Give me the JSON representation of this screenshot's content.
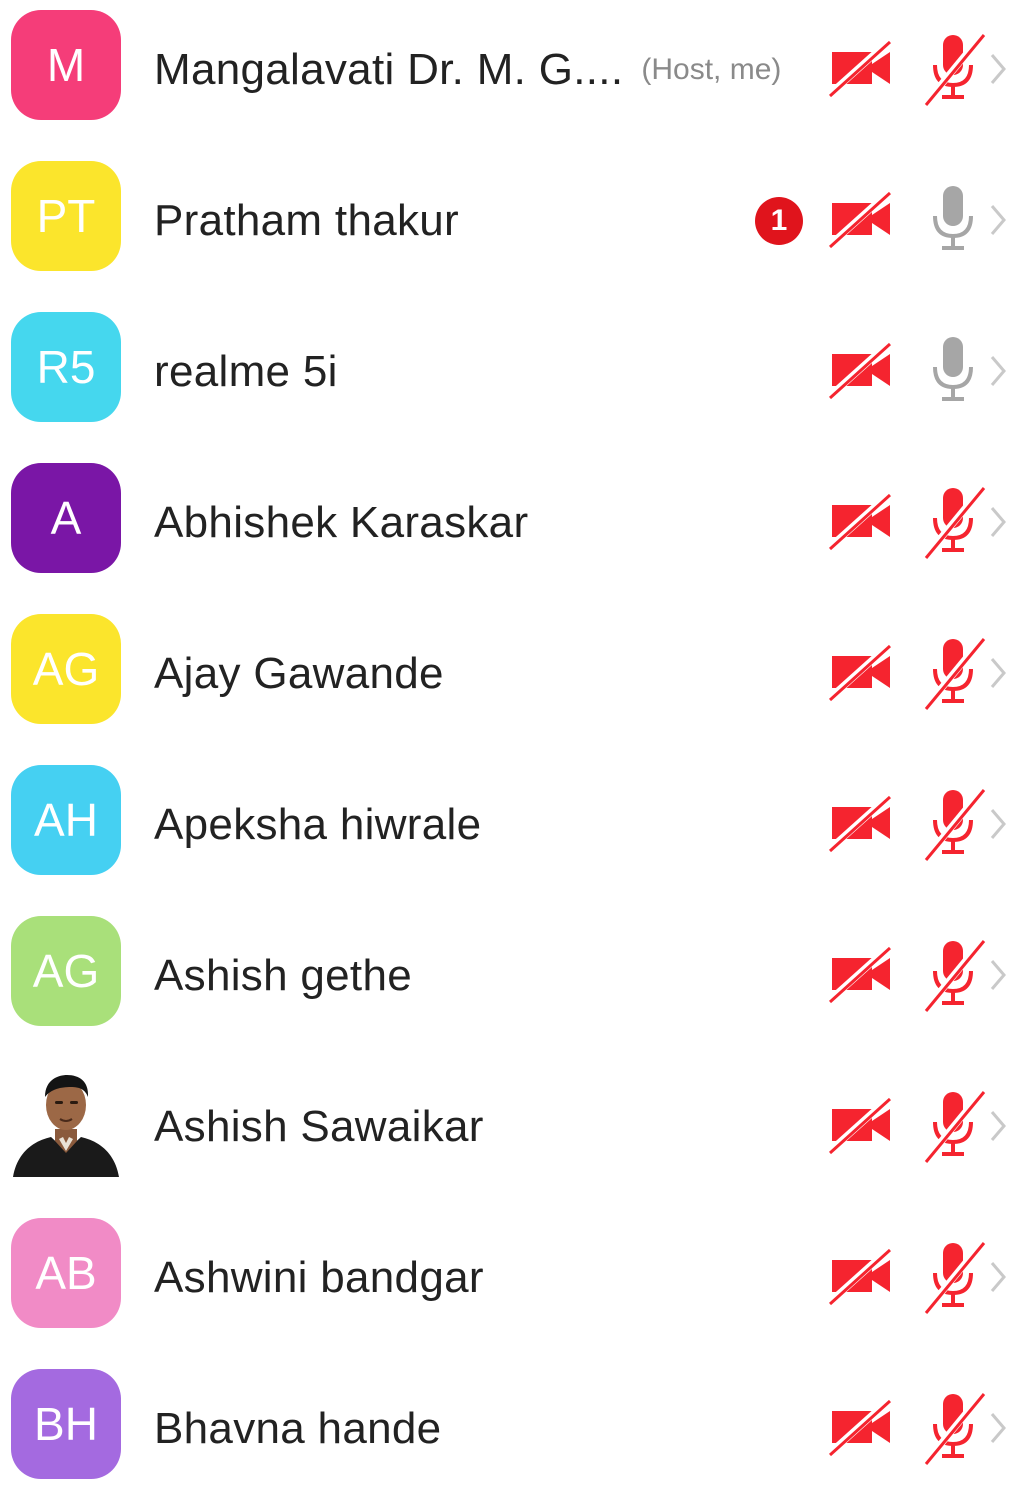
{
  "theme": {
    "muted_red": "#f5242f",
    "unmuted_gray": "#a6a6a6",
    "chevron_gray": "#c9c9c9",
    "badge_red": "#e0141c"
  },
  "participants": [
    {
      "initials": "M",
      "name": "Mangalavati Dr. M. G....",
      "tag": "(Host, me)",
      "avatar_color": "#f53d79",
      "video_icon": "video-off-icon",
      "mic_icon": "mic-off-icon",
      "mic_muted": true
    },
    {
      "initials": "PT",
      "name": "Pratham thakur",
      "badge": "1",
      "avatar_color": "#fbe52c",
      "video_icon": "video-off-icon",
      "mic_icon": "mic-icon",
      "mic_muted": false
    },
    {
      "initials": "R5",
      "name": "realme 5i",
      "avatar_color": "#45d7ee",
      "video_icon": "video-off-icon",
      "mic_icon": "mic-icon",
      "mic_muted": false
    },
    {
      "initials": "A",
      "name": "Abhishek Karaskar",
      "avatar_color": "#7a16a6",
      "video_icon": "video-off-icon",
      "mic_icon": "mic-off-icon",
      "mic_muted": true
    },
    {
      "initials": "AG",
      "name": "Ajay Gawande",
      "avatar_color": "#fbe52c",
      "video_icon": "video-off-icon",
      "mic_icon": "mic-off-icon",
      "mic_muted": true
    },
    {
      "initials": "AH",
      "name": "Apeksha hiwrale",
      "avatar_color": "#45d0f2",
      "video_icon": "video-off-icon",
      "mic_icon": "mic-off-icon",
      "mic_muted": true
    },
    {
      "initials": "AG",
      "name": "Ashish gethe",
      "avatar_color": "#a9e07a",
      "video_icon": "video-off-icon",
      "mic_icon": "mic-off-icon",
      "mic_muted": true
    },
    {
      "initials": "",
      "name": "Ashish Sawaikar",
      "avatar_icon": "profile-photo",
      "video_icon": "video-off-icon",
      "mic_icon": "mic-off-icon",
      "mic_muted": true
    },
    {
      "initials": "AB",
      "name": "Ashwini bandgar",
      "avatar_color": "#f18bc6",
      "video_icon": "video-off-icon",
      "mic_icon": "mic-off-icon",
      "mic_muted": true
    },
    {
      "initials": "BH",
      "name": "Bhavna hande",
      "avatar_color": "#a46ae0",
      "video_icon": "video-off-icon",
      "mic_icon": "mic-off-icon",
      "mic_muted": true
    }
  ]
}
